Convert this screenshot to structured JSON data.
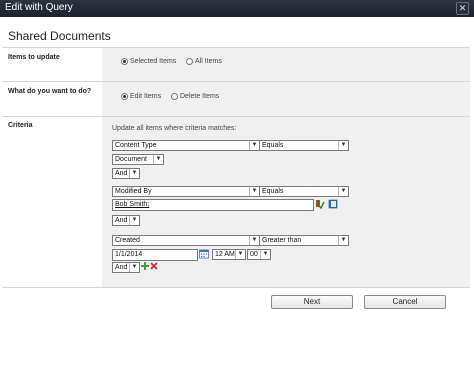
{
  "window": {
    "title": "Edit with Query",
    "close_glyph": "✕"
  },
  "page_heading": "Shared Documents",
  "items_to_update": {
    "label": "Items to update",
    "options": [
      "Selected Items",
      "All Items"
    ],
    "selected": "Selected Items"
  },
  "action": {
    "label": "What do you want to do?",
    "options": [
      "Edit Items",
      "Delete Items"
    ],
    "selected": "Edit Items"
  },
  "criteria": {
    "label": "Criteria",
    "intro": "Update all items where criteria matches:",
    "rows": [
      {
        "field": "Content Type",
        "operator": "Equals",
        "value": "Document",
        "joiner": "And"
      },
      {
        "field": "Modified By",
        "operator": "Equals",
        "value": "Bob Smith;",
        "joiner": "And"
      },
      {
        "field": "Created",
        "operator": "Greater than",
        "value": "1/1/2014",
        "hour": "12 AM",
        "minute": "00",
        "joiner": "And"
      }
    ]
  },
  "icons": {
    "check_names": "check-names-icon",
    "browse": "address-book-icon",
    "calendar": "calendar-icon",
    "add": "add-icon",
    "remove": "remove-icon"
  },
  "buttons": {
    "next": "Next",
    "cancel": "Cancel"
  },
  "colors": {
    "titlebar": "#1d222b",
    "section_bg": "#f0f0f0",
    "add_green": "#3aa33a",
    "remove_red": "#d22b2b"
  }
}
